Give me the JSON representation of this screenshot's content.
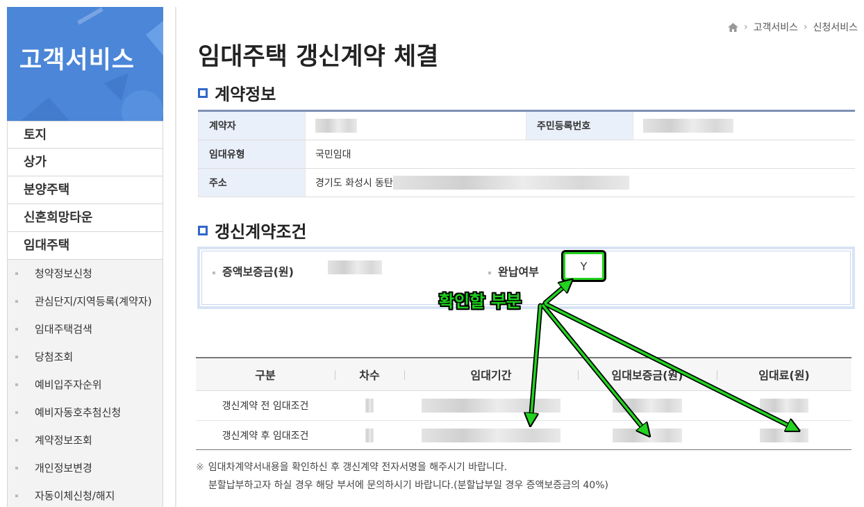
{
  "sidebar": {
    "title": "고객서비스",
    "menu": [
      "토지",
      "상가",
      "분양주택",
      "신혼희망타운",
      "임대주택"
    ],
    "submenu": [
      "청약정보신청",
      "관심단지/지역등록(계약자)",
      "임대주택검색",
      "당첨조회",
      "예비입주자순위",
      "예비자동호추첨신청",
      "계약정보조회",
      "개인정보변경",
      "자동이체신청/해지"
    ]
  },
  "breadcrumb": {
    "home_icon": "home-icon",
    "items": [
      "고객서비스",
      "신청서비스"
    ]
  },
  "page_title": "임대주택 갱신계약 체결",
  "contract_info": {
    "title": "계약정보",
    "contractor_label": "계약자",
    "resident_no_label": "주민등록번호",
    "rental_type_label": "임대유형",
    "rental_type_value": "국민임대",
    "address_label": "주소",
    "address_value": "경기도 화성시 동탄"
  },
  "renewal": {
    "title": "갱신계약조건",
    "increase_deposit_label": "증액보증금(원)",
    "paid_label": "완납여부",
    "paid_value": "Y"
  },
  "rent_table": {
    "headers": [
      "구분",
      "차수",
      "임대기간",
      "임대보증금(원)",
      "임대료(원)"
    ],
    "rows": [
      {
        "label": "갱신계약 전 임대조건"
      },
      {
        "label": "갱신계약 후 임대조건"
      }
    ]
  },
  "notes": {
    "mark": "※",
    "line1": "임대차계약서내용을 확인하신 후 갱신계약 전자서명을 해주시기 바랍니다.",
    "line2": "분할납부하고자 하실 경우 해당 부서에 문의하시기 바랍니다.(분할납부일 경우 증액보증금의 40%)"
  },
  "annotation": {
    "label": "확인할 부분",
    "color": "#22d31f"
  }
}
